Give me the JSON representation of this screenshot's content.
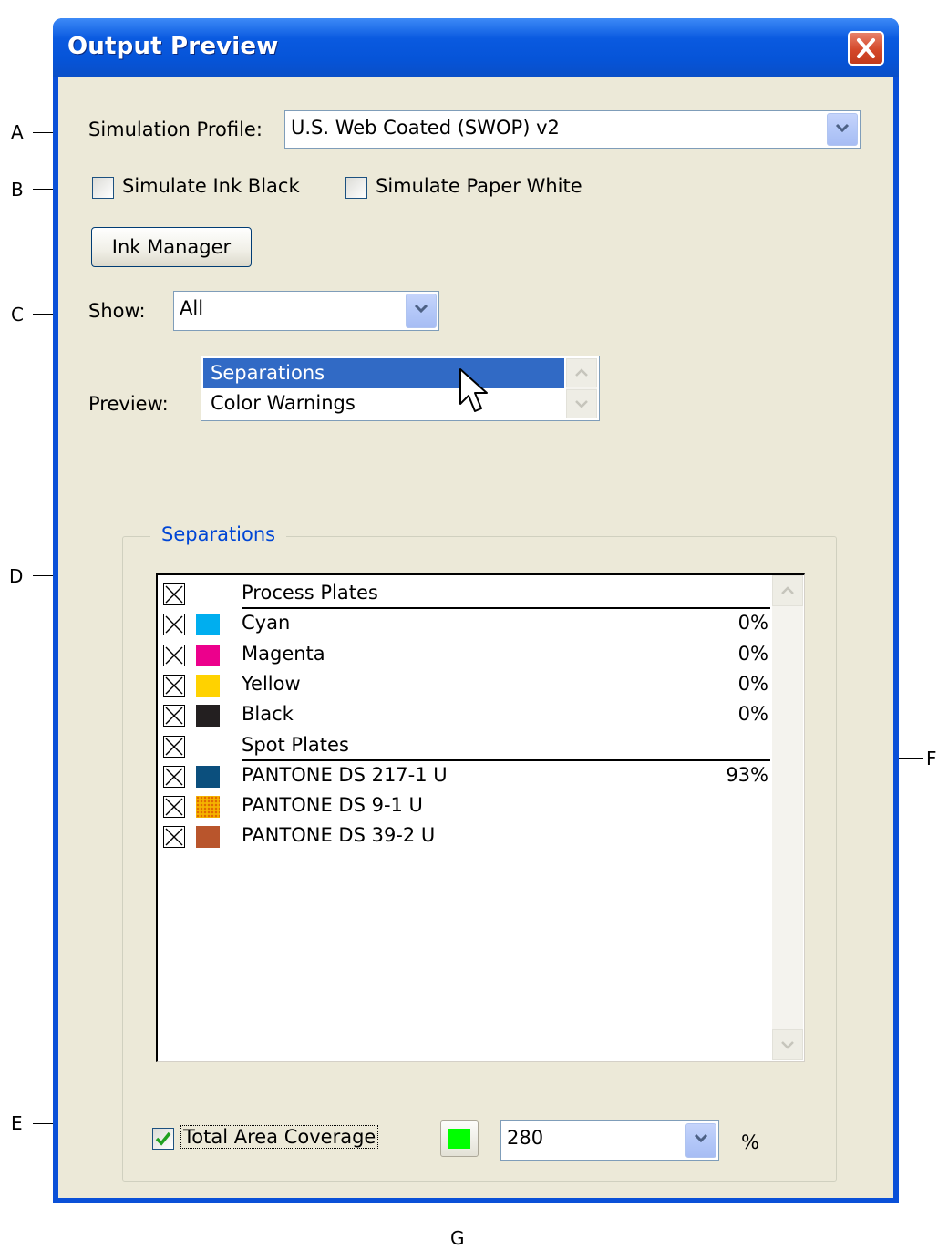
{
  "window": {
    "title": "Output Preview"
  },
  "simulation": {
    "profile_label": "Simulation Profile:",
    "profile_value": "U.S. Web Coated (SWOP) v2",
    "ink_black_label": "Simulate Ink Black",
    "ink_black_checked": false,
    "paper_white_label": "Simulate Paper White",
    "paper_white_checked": false
  },
  "ink_manager_button": "Ink Manager",
  "show": {
    "label": "Show:",
    "value": "All"
  },
  "preview": {
    "label": "Preview:",
    "options": [
      "Separations",
      "Color Warnings"
    ],
    "selected": "Separations"
  },
  "separations": {
    "group_title": "Separations",
    "rows": [
      {
        "name": "Process Plates",
        "header": true,
        "pct": "",
        "color": ""
      },
      {
        "name": "Cyan",
        "header": false,
        "pct": "0%",
        "color": "#00aeef"
      },
      {
        "name": "Magenta",
        "header": false,
        "pct": "0%",
        "color": "#ec008c"
      },
      {
        "name": "Yellow",
        "header": false,
        "pct": "0%",
        "color": "#ffd200"
      },
      {
        "name": "Black",
        "header": false,
        "pct": "0%",
        "color": "#231f20"
      },
      {
        "name": "Spot Plates",
        "header": true,
        "pct": "",
        "color": ""
      },
      {
        "name": "PANTONE DS 217-1 U",
        "header": false,
        "pct": "93%",
        "color": "#0b4f7d"
      },
      {
        "name": "PANTONE DS 9-1 U",
        "header": false,
        "pct": "",
        "color": "#f5b400"
      },
      {
        "name": "PANTONE DS 39-2 U",
        "header": false,
        "pct": "",
        "color": "#b9552c"
      }
    ]
  },
  "coverage": {
    "label": "Total Area Coverage",
    "checked": true,
    "swatch_color": "#00ff00",
    "value": "280",
    "unit": "%"
  },
  "callouts": {
    "a": "A",
    "b": "B",
    "c": "C",
    "d": "D",
    "e": "E",
    "f": "F",
    "g": "G"
  }
}
